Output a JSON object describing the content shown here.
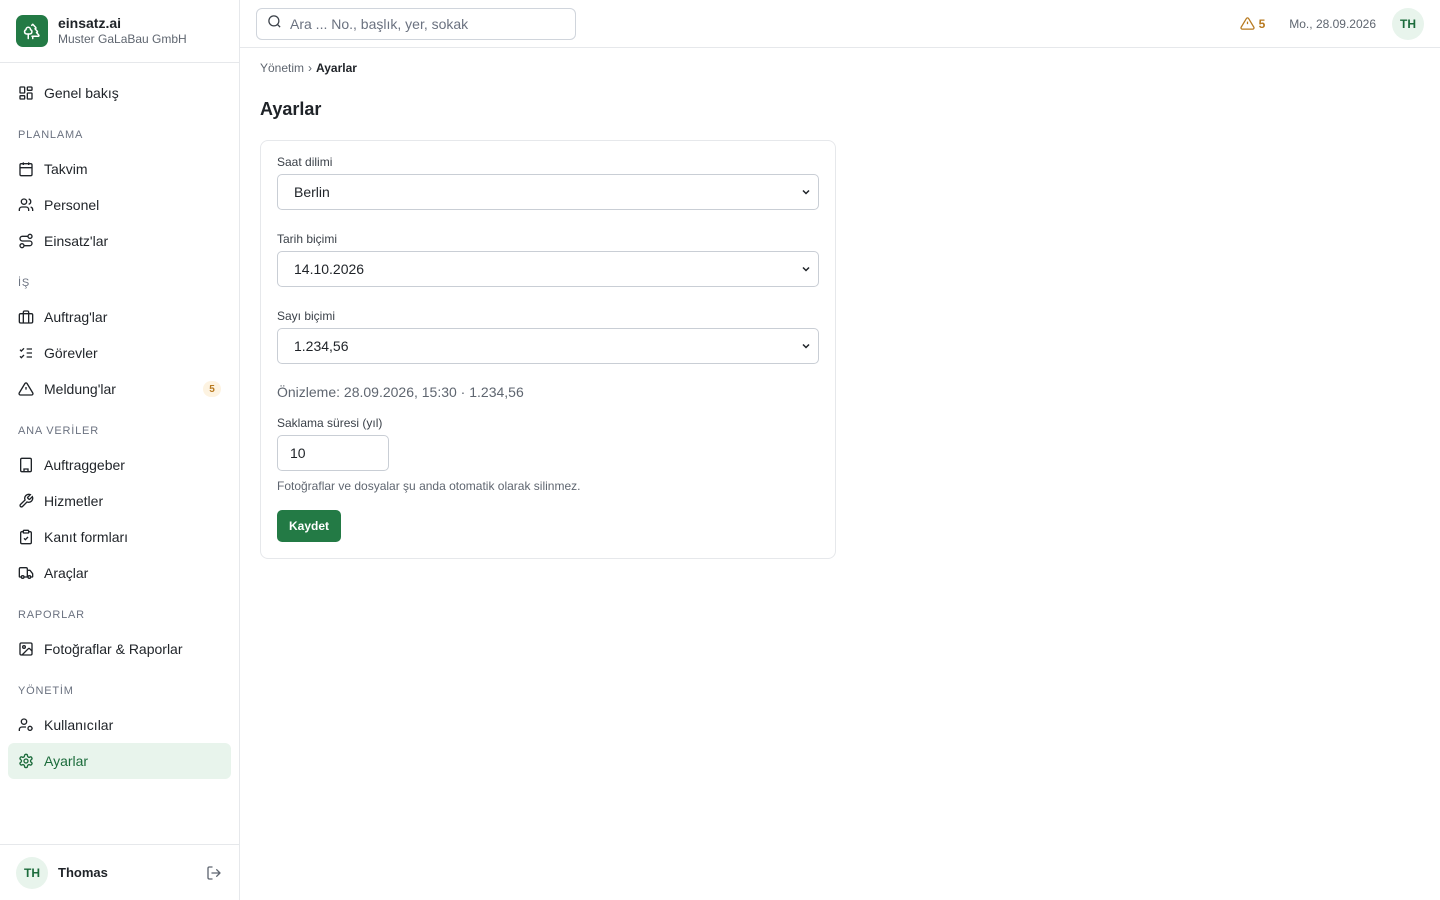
{
  "brand": {
    "name": "einsatz.ai",
    "org": "Muster GaLaBau GmbH"
  },
  "nav": {
    "overview": "Genel bakış",
    "sections": {
      "planning": "PLANLAMA",
      "work": "İŞ",
      "masterdata": "ANA VERİLER",
      "reports": "RAPORLAR",
      "admin": "YÖNETİM"
    },
    "items": {
      "calendar": "Takvim",
      "staff": "Personel",
      "assignments": "Einsatz'lar",
      "orders": "Auftrag'lar",
      "tasks": "Görevler",
      "reports_issues": "Meldung'lar",
      "clients": "Auftraggeber",
      "services": "Hizmetler",
      "forms": "Kanıt formları",
      "vehicles": "Araçlar",
      "photos": "Fotoğraflar & Raporlar",
      "users": "Kullanıcılar",
      "settings": "Ayarlar"
    },
    "meldung_badge": "5"
  },
  "user": {
    "initials": "TH",
    "name": "Thomas"
  },
  "topbar": {
    "search_placeholder": "Ara ... No., başlık, yer, sokak",
    "alert_count": "5",
    "date": "Mo., 28.09.2026",
    "avatar": "TH"
  },
  "breadcrumb": {
    "parent": "Yönetim",
    "separator": "›",
    "current": "Ayarlar"
  },
  "page": {
    "title": "Ayarlar"
  },
  "form": {
    "timezone": {
      "label": "Saat dilimi",
      "value": "Berlin"
    },
    "date_format": {
      "label": "Tarih biçimi",
      "value": "14.10.2026"
    },
    "number_format": {
      "label": "Sayı biçimi",
      "value": "1.234,56"
    },
    "preview": "Önizleme: 28.09.2026, 15:30 · 1.234,56",
    "retention": {
      "label": "Saklama süresi (yıl)",
      "value": "10"
    },
    "hint": "Fotoğraflar ve dosyalar şu anda otomatik olarak silinmez.",
    "save_label": "Kaydet"
  },
  "colors": {
    "accent": "#237a45",
    "active_bg": "#e8f4ec",
    "warning": "#b7791f"
  }
}
